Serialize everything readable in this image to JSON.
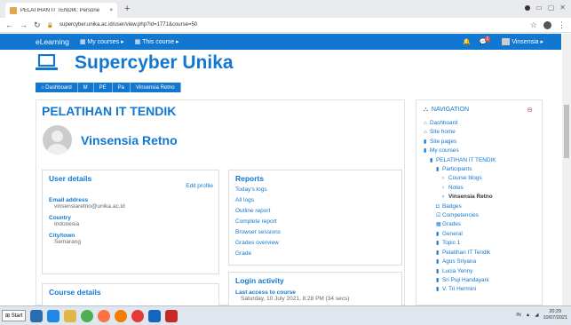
{
  "browser": {
    "tab_title": "PELATIHAN IT TENDIK: Persone",
    "url": "supercyber.unika.ac.id/user/view.php?id=1771&course=50",
    "new_tab": "+",
    "close": "×"
  },
  "topnav": {
    "brand": "eLearning",
    "my_courses": "My courses ▸",
    "this_course": "This course ▸",
    "notif_count": "1",
    "user": "Vinsensia ▸"
  },
  "site": {
    "name": "Supercyber Unika"
  },
  "breadcrumb": [
    "Dashboard",
    "M",
    "PE",
    "Pa",
    "Vinsensia Retno"
  ],
  "course": {
    "title": "PELATIHAN IT TENDIK"
  },
  "user": {
    "name": "Vinsensia Retno"
  },
  "user_details": {
    "heading": "User details",
    "edit": "Edit profile",
    "email_label": "Email address",
    "email": "vinsensiaretno@unika.ac.id",
    "country_label": "Country",
    "country": "Indonesia",
    "city_label": "City/town",
    "city": "Semarang"
  },
  "course_details": {
    "heading": "Course details"
  },
  "reports": {
    "heading": "Reports",
    "items": [
      "Today's logs",
      "All logs",
      "Outline report",
      "Complete report",
      "Browser sessions",
      "Grades overview",
      "Grade"
    ]
  },
  "login": {
    "heading": "Login activity",
    "last_label": "Last access to course",
    "last_value": "Saturday, 10 July 2021, 8:28 PM  (34 secs)"
  },
  "navigation": {
    "heading": "NAVIGATION",
    "minus": "⊖",
    "items": [
      {
        "t": "Dashboard",
        "i": "⌂",
        "d": 0
      },
      {
        "t": "Site home",
        "i": "⌂",
        "d": 0
      },
      {
        "t": "Site pages",
        "i": "▮",
        "d": 0
      },
      {
        "t": "My courses",
        "i": "▮",
        "d": 0
      },
      {
        "t": "PELATIHAN IT TENDIK",
        "i": "▮",
        "d": 1
      },
      {
        "t": "Participants",
        "i": "▮",
        "d": 2
      },
      {
        "t": "Course blogs",
        "i": "›",
        "d": 3
      },
      {
        "t": "Notes",
        "i": "›",
        "d": 3
      },
      {
        "t": "Vinsensia Retno",
        "i": "›",
        "d": 3,
        "cur": true
      },
      {
        "t": "Badges",
        "i": "◘",
        "d": 2
      },
      {
        "t": "Competencies",
        "i": "☑",
        "d": 2
      },
      {
        "t": "Grades",
        "i": "▦",
        "d": 2
      },
      {
        "t": "General",
        "i": "▮",
        "d": 2
      },
      {
        "t": "Topic 1",
        "i": "▮",
        "d": 2
      },
      {
        "t": "Pelatihan IT Tendik",
        "i": "▮",
        "d": 2
      },
      {
        "t": "Agus Sriyana",
        "i": "▮",
        "d": 2
      },
      {
        "t": "Lucia Yenny",
        "i": "▮",
        "d": 2
      },
      {
        "t": "Sri Puji Handayani",
        "i": "▮",
        "d": 2
      },
      {
        "t": "V. Tri Hermini",
        "i": "▮",
        "d": 2
      }
    ]
  },
  "taskbar": {
    "start": "Start",
    "lang": "IN",
    "time": "20:29",
    "date": "10/07/2021"
  },
  "colors": {
    "accent": "#1177d1"
  }
}
